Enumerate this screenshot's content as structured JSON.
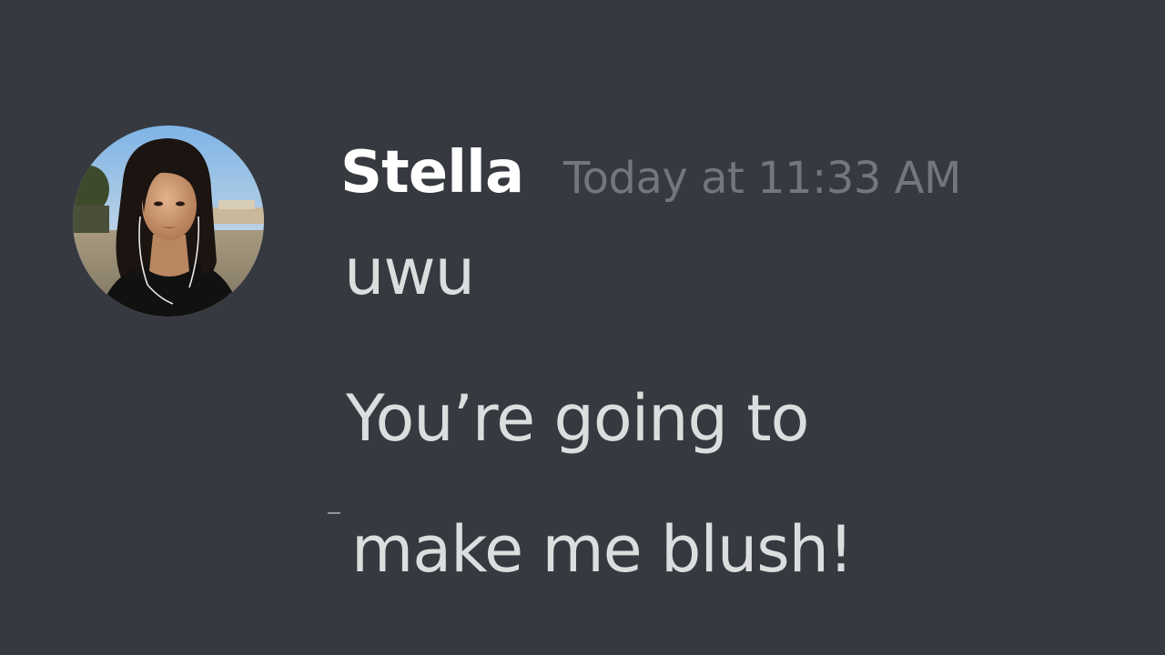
{
  "message": {
    "author": "Stella",
    "timestamp": "Today at 11:33 AM",
    "lines": [
      "uwu",
      "You’re going to",
      "make me blush!"
    ]
  },
  "colors": {
    "background": "#36393f",
    "username": "#ffffff",
    "timestamp": "#72767d",
    "message_text": "#dcddde"
  },
  "icons": {
    "avatar": "user-avatar-photo"
  }
}
